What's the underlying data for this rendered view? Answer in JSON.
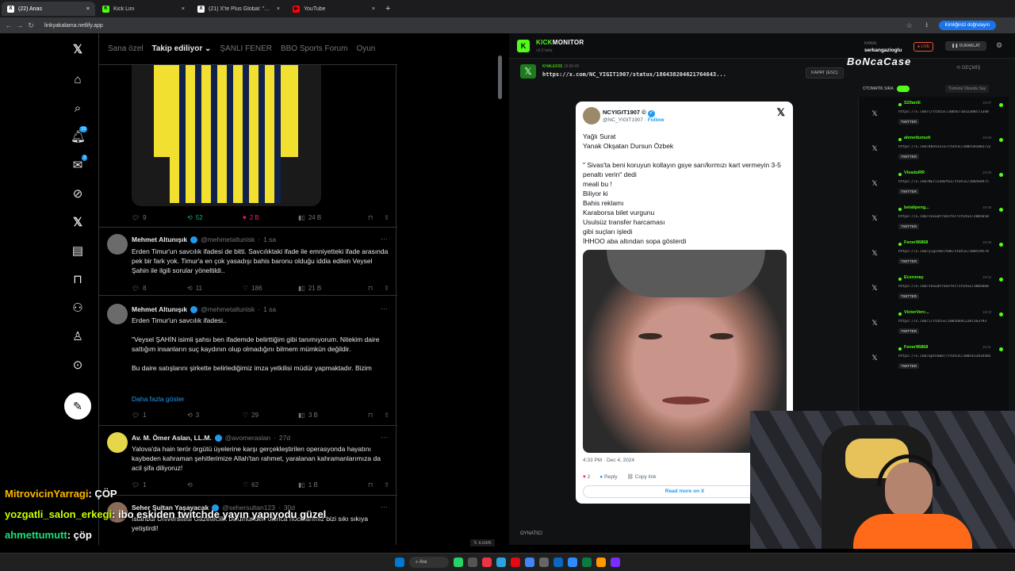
{
  "browser": {
    "tabs": [
      {
        "title": "(22) Anas",
        "icon": "X"
      },
      {
        "title": "Kick Lini",
        "icon": "K"
      },
      {
        "title": "(21) X'te Plus Global: \"Bi oyun oy",
        "icon": "X"
      },
      {
        "title": "YouTube",
        "icon": "Y"
      }
    ],
    "url": "linkyakalama.netlify.app",
    "verify": "Kimliğinizi doğrulayın"
  },
  "x": {
    "tabs": [
      "Sana özel",
      "Takip ediliyor",
      "ŞANLI FENER",
      "BBO Sports Forum",
      "Oyun"
    ],
    "notif_badge": "19",
    "msg_badge": "3",
    "top_actions": {
      "replies": "9",
      "reposts": "52",
      "likes": "2 B",
      "views": "24 B"
    },
    "tweets": [
      {
        "name": "Mehmet Altunışık",
        "handle": "@mehmetaltunisk",
        "time": "1 sa",
        "text": "Erden Timur'un savcılık ifadesi de bitti. Savcılıktaki ifade ile emniyetteki ifade arasında pek bir fark yok. Timur'a en çok yasadışı bahis baronu olduğu iddia edilen Veysel Şahin ile ilgili sorular yöneltildi..",
        "replies": "8",
        "reposts": "11",
        "likes": "186",
        "views": "21 B"
      },
      {
        "name": "Mehmet Altunışık",
        "handle": "@mehmetaltunisk",
        "time": "1 sa",
        "text": "Erden Timur'un savcılık ifadesi..\n\n\"Veysel ŞAHİN isimli şahsı ben ifademde belirttiğim gibi tanımıyorum. Nitekim daire sattığım insanların suç kaydının olup olmadığını bilmem mümkün değildir.\n\nBu daire satışlarını şirkette belirlediğimiz imza yetkilisi müdür yapmaktadır. Bizim",
        "more": "Daha fazla göster",
        "replies": "1",
        "reposts": "3",
        "likes": "29",
        "views": "3 B"
      },
      {
        "name": "Av. M. Ömer Aslan, LL.M.",
        "handle": "@avomeraslan",
        "time": "27d",
        "text": "Yalova'da hain terör örgütü üyelerine karşı gerçekleştirilen operasyonda hayatını kaybeden kahraman şehitlerimize Allah'tan rahmet, yaralanan kahramanlarımıza da acil şifa diliyoruz!",
        "replies": "1",
        "reposts": "",
        "likes": "62",
        "views": "1 B"
      },
      {
        "name": "Seher Sultan Yaşayacak",
        "handle": "@sehersultan123",
        "time": "30d",
        "text": "İstanbul Üniversitesi Gazetecilik bölümünden olunca hocalarımız bizi sıkı sıkıya yetiştirdi!\n\nNe futbol takımı tutarım ne oy veririm!"
      }
    ]
  },
  "chat": [
    {
      "user": "MitrovicinYarragi",
      "msg": ": ÇÖP"
    },
    {
      "user": "yozgatli_salon_erkegi",
      "msg": ": ibo eskiden twitchde yayın yapıyodu güzel"
    },
    {
      "user": "ahmettumutt",
      "msg": ": çöp"
    }
  ],
  "kick": {
    "title_a": "KICK",
    "title_b": "MONITOR",
    "version": "v3.0 beta",
    "channel_label": "KANAL",
    "channel": "serkangazioglu",
    "live": "LIVE",
    "pause": "DURAKLAT",
    "tweet_user": "KHALEK55",
    "tweet_time": "19:00:49",
    "tweet_url": "https://x.com/NC_YIGIT1907/status/186438204621764643...",
    "close": "KAPAT (ESC)",
    "history": "GEÇMİŞ",
    "auto": "OTOMATİK SIRA",
    "all_read": "Tümünü Okundu Say",
    "player": "OYNATICI",
    "queue": [
      {
        "name": "S20anili",
        "url": "https://x.com/i/status/2005671832300571348",
        "tag": "TWITTER",
        "time": "19:07"
      },
      {
        "name": "ahmettumutt",
        "url": "https://x.com/bbatuxio/status/2005581883722",
        "tag": "TWITTER",
        "time": "19:08"
      },
      {
        "name": "VleadoRR",
        "url": "https://x.com/Nurizadef61/status/200564975",
        "tag": "TWITTER",
        "time": "19:09"
      },
      {
        "name": "belalipeng...",
        "url": "https://x.com/sexuatransfer/status/2005650",
        "tag": "TWITTER",
        "time": "19:06"
      },
      {
        "name": "Fener96868",
        "url": "https://x.com/yigitmelt86/status/200559578",
        "tag": "TWITTER",
        "time": "19:06"
      },
      {
        "name": "Eceronay",
        "url": "https://x.com/sexuatransfer/status/2005668",
        "tag": "TWITTER",
        "time": "19:02"
      },
      {
        "name": "VictorVerc...",
        "url": "https://x.com/i/status/200566912287263793",
        "tag": "TWITTER",
        "time": "19:02"
      },
      {
        "name": "Fener96868",
        "url": "https://x.com/aptnaber/status/2005412814485",
        "tag": "TWITTER",
        "time": "19:11"
      }
    ]
  },
  "embed": {
    "name": "NCYIGIT1907",
    "handle": "@NC_YIGIT1907",
    "follow": "Follow",
    "text": "Yağlı Surat\nYanak Okşatan Dursun Özbek\n\n\" Sivas'ta beni koruyun kollayın gsye sarı/kırmızı kart vermeyin 3-5 penaltı verin\" dedi\nmeali bu !\nBiliyor ki\nBahis reklamı\nKaraborsa bilet vurgunu\nUsulsüz transfer harcaması\ngibi suçları işledi\nİHHOO aba altından sopa gösterdi",
    "time": "4:33 PM · Dec 4, 2024",
    "likes": "2",
    "reply": "Reply",
    "copy": "Copy link",
    "read_more": "Read more on X"
  },
  "xfoot": "x.com",
  "taskbar_search": "Ara",
  "watermark": "BoNcaCase"
}
